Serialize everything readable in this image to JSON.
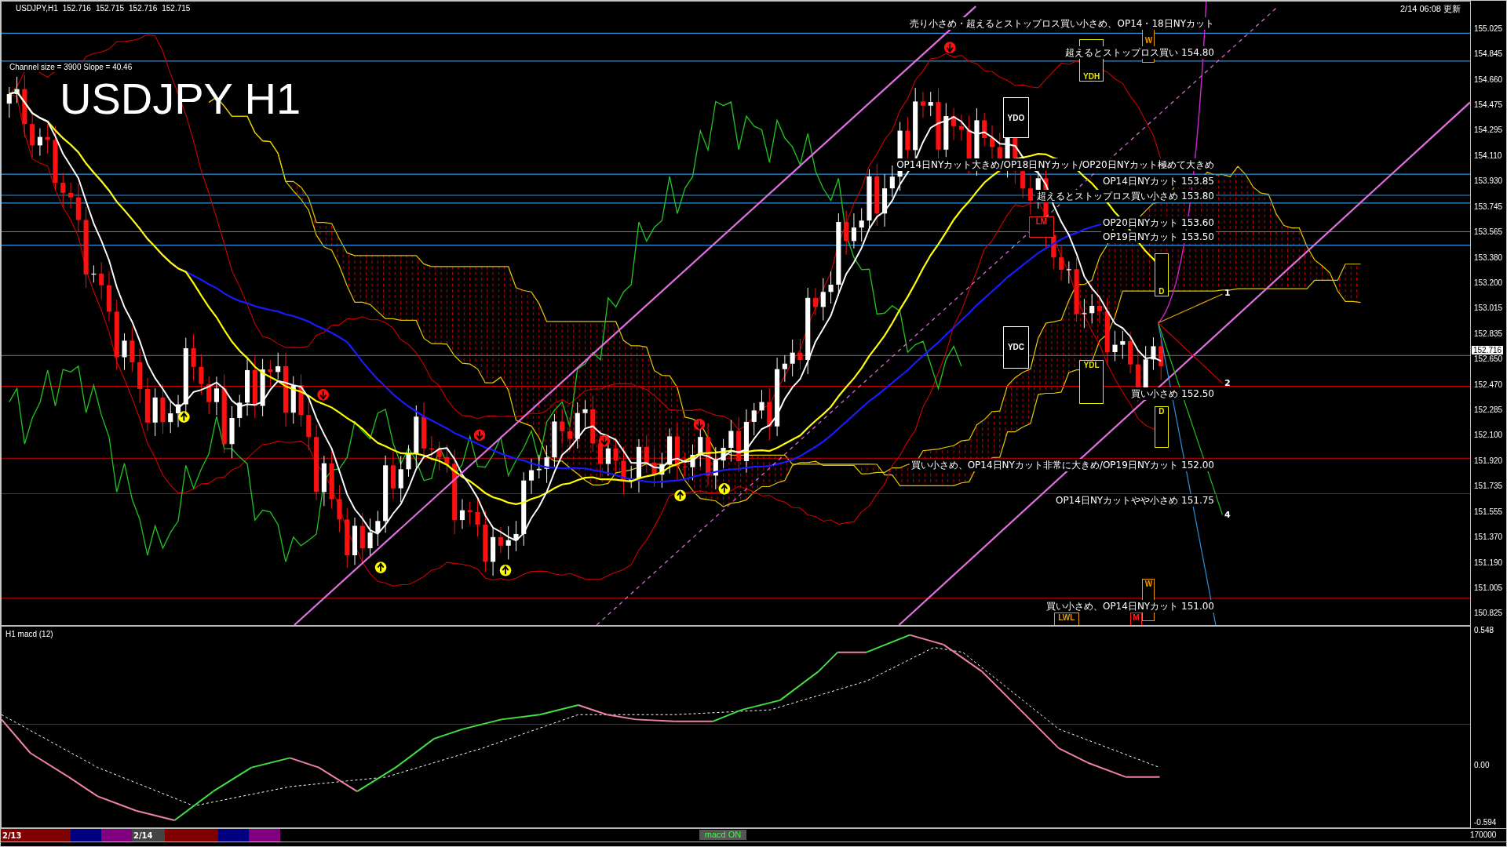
{
  "header": {
    "symbol": "USDJPY,H1",
    "quotes": [
      "152.716",
      "152.715",
      "152.716",
      "152.715"
    ]
  },
  "channel_info": "Channel size = 3900 Slope = 40.46",
  "chart_title": "USDJPY H1",
  "update_time": "2/14 06:08 更新",
  "price_axis": {
    "labels": [
      "155.025",
      "154.845",
      "154.660",
      "154.475",
      "154.295",
      "154.110",
      "153.930",
      "153.745",
      "153.565",
      "153.380",
      "153.200",
      "153.015",
      "152.835",
      "152.650",
      "152.470",
      "152.285",
      "152.100",
      "151.920",
      "151.735",
      "151.555",
      "151.370",
      "151.190",
      "151.005",
      "150.825"
    ],
    "current_price": "152.716"
  },
  "annotations": [
    {
      "text": "売り小さめ・超えるとストップロス買い小さめ、OP14・18日NYカット"
    },
    {
      "text": "超えるとストップロス買い 154.80"
    },
    {
      "text": "OP14日NYカット大きめ/OP18日NYカット/OP20日NYカット極めて大きめ"
    },
    {
      "text": "OP14日NYカット 153.85"
    },
    {
      "text": "超えるとストップロス買い小さめ 153.80"
    },
    {
      "text": "OP20日NYカット 153.60"
    },
    {
      "text": "OP19日NYカット 153.50"
    },
    {
      "text": "買い小さめ 152.50"
    },
    {
      "text": "買い小さめ、OP14日NYカット非常に大きめ/OP19日NYカット 152.00"
    },
    {
      "text": "OP14日NYカットやや小さめ 151.75"
    },
    {
      "text": "買い小さめ、OP14日NYカット 151.00"
    }
  ],
  "level_markers": [
    {
      "label": "YDH",
      "color": "#e8e800"
    },
    {
      "label": "W",
      "color": "#e89a00"
    },
    {
      "label": "YDO",
      "color": "#ffffff"
    },
    {
      "label": "LM",
      "color": "#ff2020"
    },
    {
      "label": "D",
      "color": "#e8e800"
    },
    {
      "label": "YDC",
      "color": "#ffffff"
    },
    {
      "label": "YDL",
      "color": "#e8e800"
    },
    {
      "label": "D",
      "color": "#e8e800"
    },
    {
      "label": "W",
      "color": "#e89a00"
    },
    {
      "label": "LWL",
      "color": "#e89a00"
    },
    {
      "label": "M",
      "color": "#ff2020"
    }
  ],
  "wave_labels": [
    "1",
    "2",
    "4"
  ],
  "macd": {
    "title": "H1  macd (12)",
    "axis_labels": [
      "0.548",
      "0.00",
      "-0.594"
    ],
    "volume_label": "170000"
  },
  "session_bar": {
    "dates": [
      "2/13",
      "2/14"
    ]
  },
  "indicator_button": {
    "label": "macd ON"
  }
}
